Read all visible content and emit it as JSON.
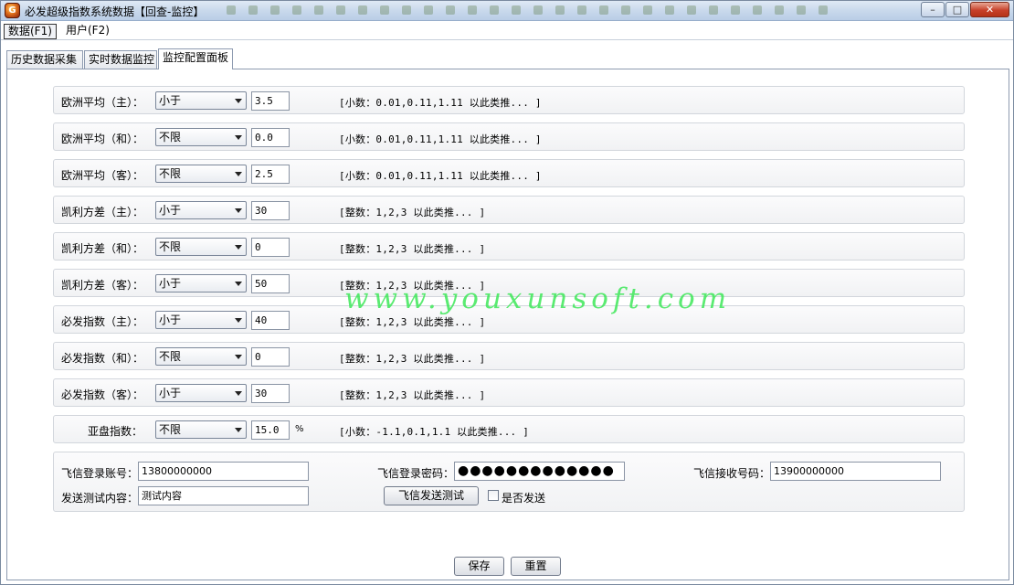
{
  "window": {
    "title": "必发超级指数系统数据【回查-监控】",
    "icon": "app-logo-icon"
  },
  "menu": {
    "items": [
      {
        "label": "数据(F1)"
      },
      {
        "label": "用户(F2)"
      }
    ]
  },
  "tabs": [
    {
      "label": "历史数据采集"
    },
    {
      "label": "实时数据监控"
    },
    {
      "label": "监控配置面板"
    }
  ],
  "rows": [
    {
      "label": "欧洲平均（主）：",
      "select": "小于",
      "value": "3.5",
      "hint": "[小数：0.01,0.11,1.11 以此类推... ]"
    },
    {
      "label": "欧洲平均（和）：",
      "select": "不限",
      "value": "0.0",
      "hint": "[小数：0.01,0.11,1.11 以此类推... ]"
    },
    {
      "label": "欧洲平均（客）：",
      "select": "不限",
      "value": "2.5",
      "hint": "[小数：0.01,0.11,1.11 以此类推... ]"
    },
    {
      "label": "凯利方差（主）：",
      "select": "小于",
      "value": "30",
      "hint": "[整数：1,2,3 以此类推... ]"
    },
    {
      "label": "凯利方差（和）：",
      "select": "不限",
      "value": "0",
      "hint": "[整数：1,2,3 以此类推... ]"
    },
    {
      "label": "凯利方差（客）：",
      "select": "小于",
      "value": "50",
      "hint": "[整数：1,2,3 以此类推... ]"
    },
    {
      "label": "必发指数（主）：",
      "select": "小于",
      "value": "40",
      "hint": "[整数：1,2,3 以此类推... ]"
    },
    {
      "label": "必发指数（和）：",
      "select": "不限",
      "value": "0",
      "hint": "[整数：1,2,3 以此类推... ]"
    },
    {
      "label": "必发指数（客）：",
      "select": "小于",
      "value": "30",
      "hint": "[整数：1,2,3 以此类推... ]"
    }
  ],
  "asia": {
    "label": "亚盘指数：",
    "select": "不限",
    "value": "15.0",
    "unit": "%",
    "hint": "[小数：-1.1,0.1,1.1 以此类推... ]"
  },
  "fetion": {
    "account_label": "飞信登录账号：",
    "account_value": "13800000000",
    "password_label": "飞信登录密码：",
    "password_value": "●●●●●●●●●●●●●",
    "receiver_label": "飞信接收号码：",
    "receiver_value": "13900000000",
    "test_label": "发送测试内容：",
    "test_value": "测试内容",
    "test_button": "飞信发送测试",
    "send_checkbox_label": "是否发送"
  },
  "footer": {
    "save": "保存",
    "reset": "重置"
  },
  "watermark": "www.youxunsoft.com"
}
